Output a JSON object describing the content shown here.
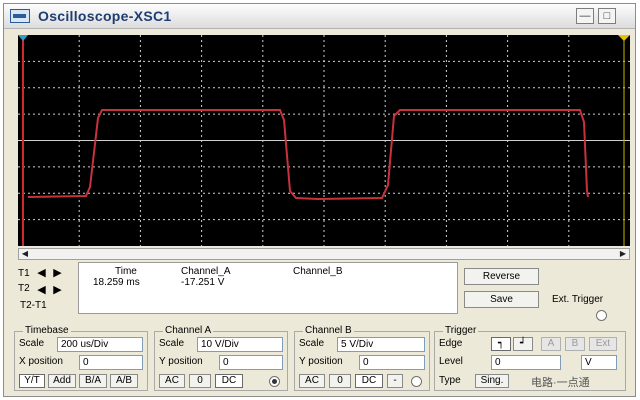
{
  "window": {
    "title": "Oscilloscope-XSC1"
  },
  "titlebar_buttons": [
    "—",
    "□"
  ],
  "cursor_markers": {
    "t1": "T1",
    "t2": "T2",
    "t2_t1": "T2-T1"
  },
  "readout": {
    "headers": {
      "time": "Time",
      "channel_a": "Channel_A",
      "channel_b": "Channel_B"
    },
    "t1_row": {
      "time": "18.259 ms",
      "channel_a": "-17.251  V",
      "channel_b": ""
    }
  },
  "buttons": {
    "reverse": "Reverse",
    "save": "Save",
    "ext_trigger": "Ext. Trigger"
  },
  "timebase": {
    "title": "Timebase",
    "scale_label": "Scale",
    "scale_value": "200 us/Div",
    "xpos_label": "X position",
    "xpos_value": "0",
    "modes": [
      "Y/T",
      "Add",
      "B/A",
      "A/B"
    ]
  },
  "channel_a": {
    "title": "Channel A",
    "scale_label": "Scale",
    "scale_value": "10  V/Div",
    "ypos_label": "Y position",
    "ypos_value": "0",
    "coupling": [
      "AC",
      "0",
      "DC"
    ]
  },
  "channel_b": {
    "title": "Channel B",
    "scale_label": "Scale",
    "scale_value": "5  V/Div",
    "ypos_label": "Y position",
    "ypos_value": "0",
    "coupling": [
      "AC",
      "0",
      "DC",
      "-"
    ]
  },
  "trigger": {
    "title": "Trigger",
    "edge_label": "Edge",
    "edge_rising": "┑",
    "edge_falling": "┙",
    "sources": [
      "A",
      "B",
      "Ext"
    ],
    "level_label": "Level",
    "level_value": "0",
    "level_unit": "V",
    "type_label": "Type",
    "type_value": "Sing.",
    "watermark": "电路·一点通"
  },
  "colors": {
    "screen_bg": "#000000",
    "grid": "#cfcfcf",
    "trace_a": "#c8323c",
    "cursor_t1": "#d22828",
    "panel_bg": "#ece9d8"
  }
}
